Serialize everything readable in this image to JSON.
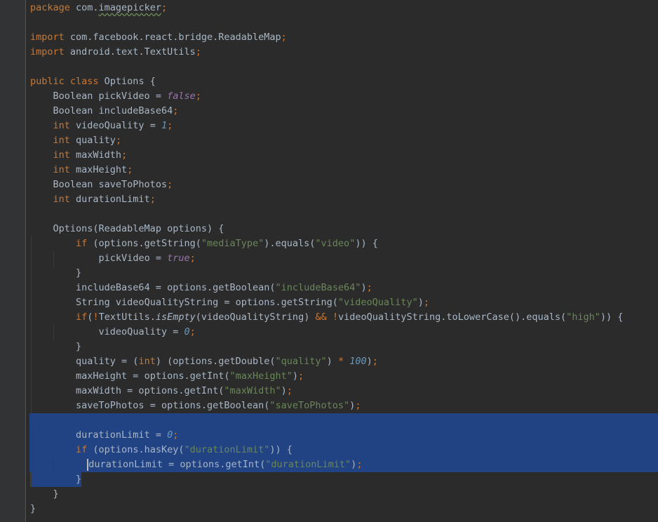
{
  "editor": {
    "language": "Java",
    "colors": {
      "background": "#2b2b2b",
      "gutter": "#313335",
      "keyword": "#cc7832",
      "string": "#6a8759",
      "number": "#6897bb",
      "literal": "#9876aa",
      "default": "#a9b7c6",
      "selection": "#214283"
    },
    "lines": [
      {
        "segments": [
          {
            "t": "package ",
            "c": "kw"
          },
          {
            "t": "com."
          },
          {
            "t": "imagepicker",
            "c": "squiggle"
          },
          {
            "t": ";",
            "c": "kw"
          }
        ]
      },
      {
        "segments": []
      },
      {
        "segments": [
          {
            "t": "import ",
            "c": "kw"
          },
          {
            "t": "com.facebook.react.bridge.ReadableMap"
          },
          {
            "t": ";",
            "c": "kw"
          }
        ]
      },
      {
        "segments": [
          {
            "t": "import ",
            "c": "kw"
          },
          {
            "t": "android.text.TextUtils"
          },
          {
            "t": ";",
            "c": "kw"
          }
        ]
      },
      {
        "segments": []
      },
      {
        "segments": [
          {
            "t": "public class ",
            "c": "kw"
          },
          {
            "t": "Options {"
          }
        ]
      },
      {
        "indent": 4,
        "segments": [
          {
            "t": "Boolean pickVideo = "
          },
          {
            "t": "false",
            "c": "lit"
          },
          {
            "t": ";",
            "c": "kw"
          }
        ]
      },
      {
        "indent": 4,
        "segments": [
          {
            "t": "Boolean includeBase64"
          },
          {
            "t": ";",
            "c": "kw"
          }
        ]
      },
      {
        "indent": 4,
        "segments": [
          {
            "t": "int ",
            "c": "kw"
          },
          {
            "t": "videoQuality = "
          },
          {
            "t": "1",
            "c": "num"
          },
          {
            "t": ";",
            "c": "kw"
          }
        ]
      },
      {
        "indent": 4,
        "segments": [
          {
            "t": "int ",
            "c": "kw"
          },
          {
            "t": "quality"
          },
          {
            "t": ";",
            "c": "kw"
          }
        ]
      },
      {
        "indent": 4,
        "segments": [
          {
            "t": "int ",
            "c": "kw"
          },
          {
            "t": "maxWidth"
          },
          {
            "t": ";",
            "c": "kw"
          }
        ]
      },
      {
        "indent": 4,
        "segments": [
          {
            "t": "int ",
            "c": "kw"
          },
          {
            "t": "maxHeight"
          },
          {
            "t": ";",
            "c": "kw"
          }
        ]
      },
      {
        "indent": 4,
        "segments": [
          {
            "t": "Boolean saveToPhotos"
          },
          {
            "t": ";",
            "c": "kw"
          }
        ]
      },
      {
        "indent": 4,
        "segments": [
          {
            "t": "int ",
            "c": "kw"
          },
          {
            "t": "durationLimit"
          },
          {
            "t": ";",
            "c": "kw"
          }
        ]
      },
      {
        "segments": []
      },
      {
        "indent": 4,
        "segments": [
          {
            "t": "Options(ReadableMap options) {"
          }
        ]
      },
      {
        "indent": 8,
        "segments": [
          {
            "t": "if ",
            "c": "kw"
          },
          {
            "t": "(options.getString("
          },
          {
            "t": "\"mediaType\"",
            "c": "str"
          },
          {
            "t": ").equals("
          },
          {
            "t": "\"video\"",
            "c": "str"
          },
          {
            "t": ")) {"
          }
        ]
      },
      {
        "indent": 12,
        "segments": [
          {
            "t": "pickVideo = "
          },
          {
            "t": "true",
            "c": "lit"
          },
          {
            "t": ";",
            "c": "kw"
          }
        ]
      },
      {
        "indent": 8,
        "segments": [
          {
            "t": "}"
          }
        ]
      },
      {
        "indent": 8,
        "segments": [
          {
            "t": "includeBase64 = options.getBoolean("
          },
          {
            "t": "\"includeBase64\"",
            "c": "str"
          },
          {
            "t": ")"
          },
          {
            "t": ";",
            "c": "kw"
          }
        ]
      },
      {
        "indent": 8,
        "segments": [
          {
            "t": "String videoQualityString = options.getString("
          },
          {
            "t": "\"videoQuality\"",
            "c": "str"
          },
          {
            "t": ")"
          },
          {
            "t": ";",
            "c": "kw"
          }
        ]
      },
      {
        "indent": 8,
        "segments": [
          {
            "t": "if",
            "c": "kw"
          },
          {
            "t": "("
          },
          {
            "t": "!",
            "c": "kw"
          },
          {
            "t": "TextUtils."
          },
          {
            "t": "isEmpty",
            "c": "ital"
          },
          {
            "t": "(videoQualityString) "
          },
          {
            "t": "&&",
            "c": "kw"
          },
          {
            "t": " "
          },
          {
            "t": "!",
            "c": "kw"
          },
          {
            "t": "videoQualityString.toLowerCase().equals("
          },
          {
            "t": "\"high\"",
            "c": "str"
          },
          {
            "t": ")) {"
          }
        ]
      },
      {
        "indent": 12,
        "segments": [
          {
            "t": "videoQuality = "
          },
          {
            "t": "0",
            "c": "num"
          },
          {
            "t": ";",
            "c": "kw"
          }
        ]
      },
      {
        "indent": 8,
        "segments": [
          {
            "t": "}"
          }
        ]
      },
      {
        "indent": 8,
        "segments": [
          {
            "t": "quality = ("
          },
          {
            "t": "int",
            "c": "kw"
          },
          {
            "t": ") (options.getDouble("
          },
          {
            "t": "\"quality\"",
            "c": "str"
          },
          {
            "t": ") "
          },
          {
            "t": "*",
            "c": "kw"
          },
          {
            "t": " "
          },
          {
            "t": "100",
            "c": "num"
          },
          {
            "t": ")"
          },
          {
            "t": ";",
            "c": "kw"
          }
        ]
      },
      {
        "indent": 8,
        "segments": [
          {
            "t": "maxHeight = options.getInt("
          },
          {
            "t": "\"maxHeight\"",
            "c": "str"
          },
          {
            "t": ")"
          },
          {
            "t": ";",
            "c": "kw"
          }
        ]
      },
      {
        "indent": 8,
        "segments": [
          {
            "t": "maxWidth = options.getInt("
          },
          {
            "t": "\"maxWidth\"",
            "c": "str"
          },
          {
            "t": ")"
          },
          {
            "t": ";",
            "c": "kw"
          }
        ]
      },
      {
        "indent": 8,
        "segments": [
          {
            "t": "saveToPhotos = options.getBoolean("
          },
          {
            "t": "\"saveToPhotos\"",
            "c": "str"
          },
          {
            "t": ")"
          },
          {
            "t": ";",
            "c": "kw"
          }
        ]
      },
      {
        "selection": "full",
        "segments": []
      },
      {
        "selection": "full",
        "indent": 8,
        "segments": [
          {
            "t": "durationLimit = "
          },
          {
            "t": "0",
            "c": "num"
          },
          {
            "t": ";",
            "c": "kw"
          }
        ]
      },
      {
        "selection": "full",
        "indent": 8,
        "segments": [
          {
            "t": "if ",
            "c": "kw"
          },
          {
            "t": "(options.hasKey("
          },
          {
            "t": "\"durationLimit\"",
            "c": "str"
          },
          {
            "t": ")) {"
          }
        ]
      },
      {
        "selection": "full",
        "indent": 10,
        "caret": true,
        "segments": [
          {
            "t": "durationLimit = options.getInt("
          },
          {
            "t": "\"durationLimit\"",
            "c": "str"
          },
          {
            "t": ")"
          },
          {
            "t": ";",
            "c": "kw"
          }
        ]
      },
      {
        "selection": "partial",
        "indent": 8,
        "segments": [
          {
            "t": "}"
          }
        ]
      },
      {
        "indent": 4,
        "segments": [
          {
            "t": "}"
          }
        ]
      },
      {
        "segments": [
          {
            "t": "}"
          }
        ]
      }
    ]
  }
}
